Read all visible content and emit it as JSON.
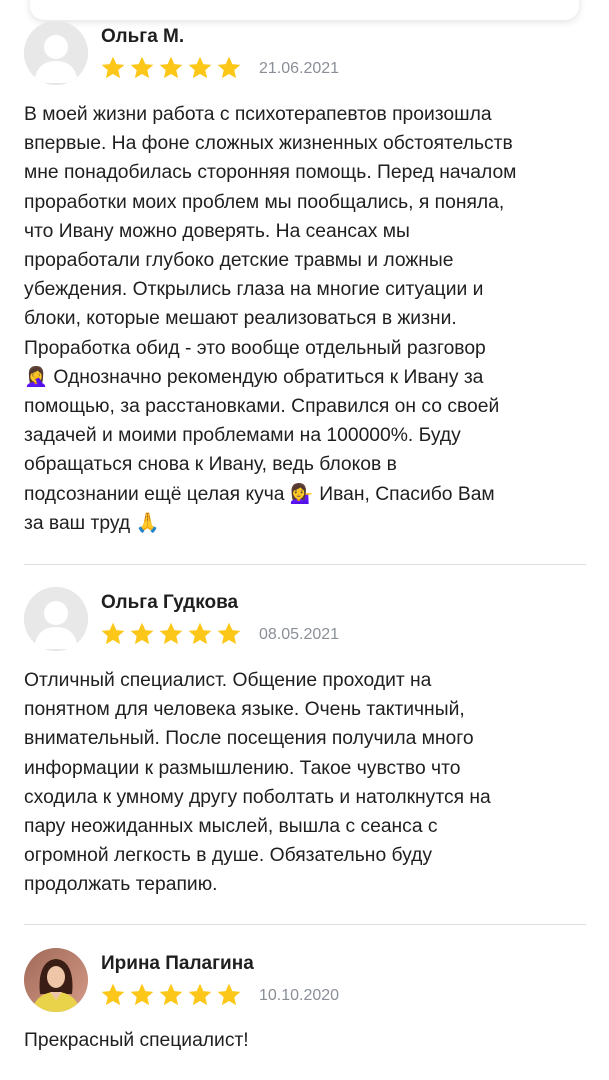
{
  "reviews": [
    {
      "author": "Ольга М.",
      "rating": 5,
      "date": "21.06.2021",
      "avatar": "default-user-avatar",
      "text_lines": [
        "В моей жизни работа с психотерапевтов произошла",
        "впервые. На фоне сложных жизненных обстоятельств",
        "мне понадобилась сторонняя помощь. Перед началом",
        "проработки моих проблем мы пообщались, я поняла,",
        "что Ивану можно доверять. На сеансах мы",
        "проработали глубоко детские травмы и ложные",
        "убеждения. Открылись глаза на многие ситуации и",
        "блоки, которые мешают реализоваться в жизни.",
        "Проработка обид - это вообще отдельный разговор",
        "🤦‍♀️ Однозначно рекомендую обратиться к Ивану за",
        "помощью, за расстановками. Справился он со своей",
        "задачей и моими проблемами на 100000%. Буду",
        "обращаться снова к Ивану, ведь блоков в",
        "подсознании ещё целая куча 💁‍♀️ Иван, Спасибо Вам",
        "за ваш труд 🙏"
      ]
    },
    {
      "author": "Ольга Гудкова",
      "rating": 5,
      "date": "08.05.2021",
      "avatar": "default-user-avatar",
      "text_lines": [
        "Отличный специалист. Общение проходит на",
        "понятном для человека языке. Очень тактичный,",
        "внимательный. После посещения получила много",
        "информации к размышлению. Такое чувство что",
        "сходила к умному другу поболтать и натолкнутся на",
        "пару неожиданных мыслей, вышла с сеанса с",
        "огромной легкость в душе. Обязательно буду",
        "продолжать терапию."
      ]
    },
    {
      "author": "Ирина Палагина",
      "rating": 5,
      "date": "10.10.2020",
      "avatar": "photo-avatar",
      "text_lines": [
        "Прекрасный специалист!"
      ]
    }
  ],
  "colors": {
    "star": "#fdc719",
    "date": "#8a8f97",
    "divider": "#dedede",
    "avatar_bg": "#e8e8e8"
  }
}
